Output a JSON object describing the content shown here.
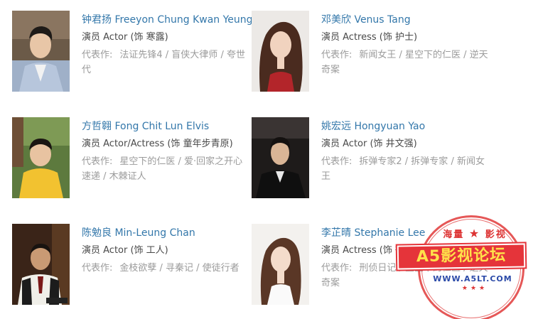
{
  "cast": [
    {
      "name": "钟君扬 Freeyon Chung Kwan Yeung",
      "role": "演员 Actor (饰 寒露)",
      "works_label": "代表作:",
      "works_line1": "法证先锋4 / 盲侠大律师 / 夸世",
      "works_line2": "代"
    },
    {
      "name": "邓美欣 Venus Tang",
      "role": "演员 Actress (饰 护士)",
      "works_label": "代表作:",
      "works_line1": "新闻女王 / 星空下的仁医 / 逆天",
      "works_line2": "奇案"
    },
    {
      "name": "方哲翱 Fong Chit Lun Elvis",
      "role": "演员 Actor/Actress (饰 童年步青原)",
      "works_label": "代表作:",
      "works_line1": "星空下的仁医 / 爱·回家之开心",
      "works_line2": "速递 / 木棘证人"
    },
    {
      "name": "姚宏远 Hongyuan Yao",
      "role": "演员 Actor (饰 井文强)",
      "works_label": "代表作:",
      "works_line1": "拆弹专家2 / 拆弹专家 / 新闻女",
      "works_line2": "王"
    },
    {
      "name": "陈勉良 Min-Leung Chan",
      "role": "演员 Actor (饰 工人)",
      "works_label": "代表作:",
      "works_line1": "金枝欲孽 / 寻秦记 / 使徒行者",
      "works_line2": ""
    },
    {
      "name": "李芷晴 Stephanie Lee",
      "role": "演员 Actress (饰 街坊)",
      "works_label": "代表作:",
      "works_line1": "刑侦日记 / 星空下的仁医 / 逆天",
      "works_line2": "奇案"
    }
  ],
  "watermark": {
    "top_left": "海量",
    "top_right": "影视",
    "title": "A5影视论坛",
    "url": "WWW.A5LT.COM",
    "stamp_color": "#e03a3a"
  },
  "colors": {
    "name_link": "#3377aa",
    "role_text": "#494949",
    "works_text": "#9b9b9b"
  }
}
